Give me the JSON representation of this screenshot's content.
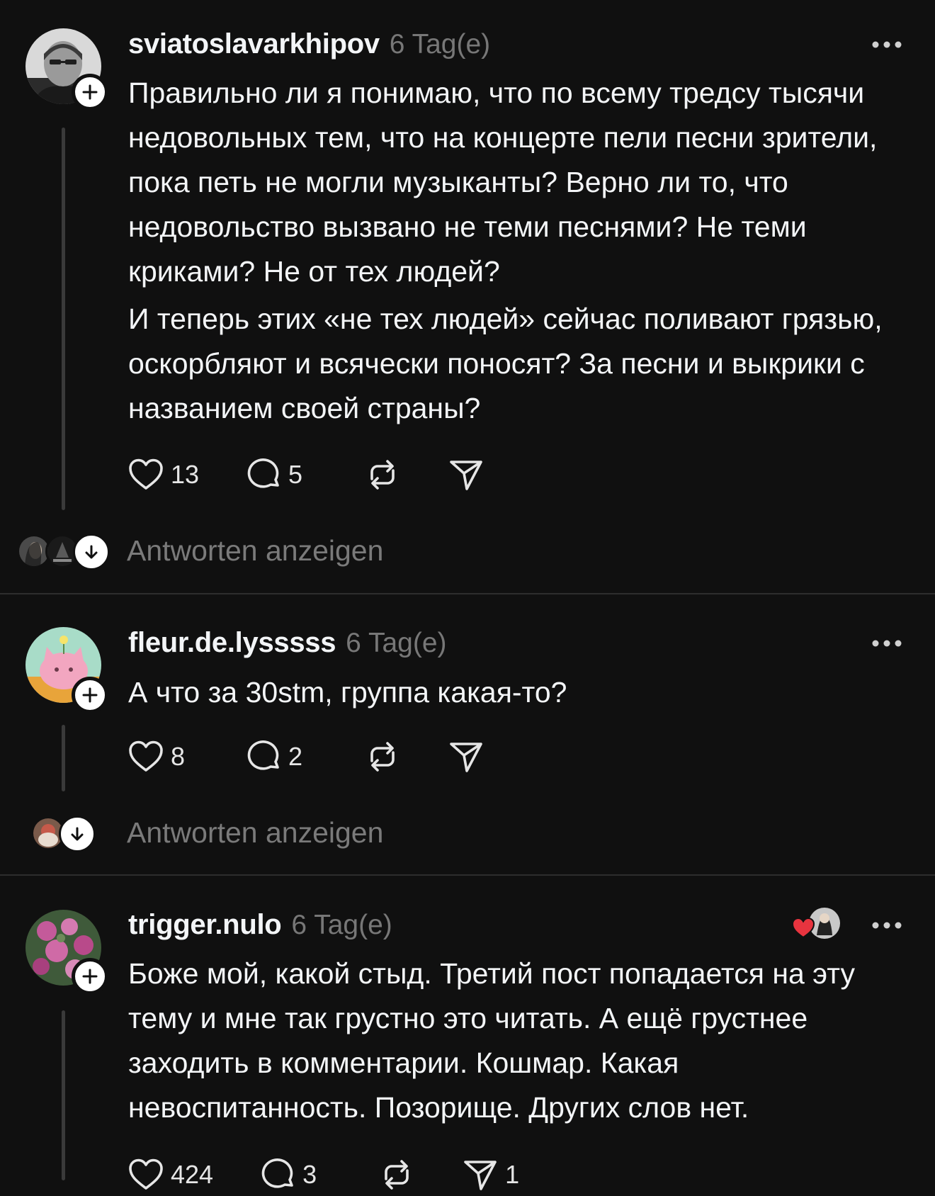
{
  "posts": [
    {
      "username": "sviatoslavarkhipov",
      "time": "6 Tag(e)",
      "paragraphs": [
        "Правильно ли я понимаю, что по всему тредсу тысячи недовольных тем, что на концерте пели песни зрители, пока петь не могли музыканты? Верно ли то, что недовольство вызвано не теми песнями? Не теми криками? Не от тех людей?",
        "И теперь этих «не тех людей» сейчас поливают грязью, оскорбляют и всячески поносят? За песни и выкрики с названием своей страны?"
      ],
      "likes": "13",
      "comments": "5",
      "replies_label": "Antworten anzeigen"
    },
    {
      "username": "fleur.de.lysssss",
      "time": "6 Tag(e)",
      "paragraphs": [
        "А что за 30stm, группа какая-то?"
      ],
      "likes": "8",
      "comments": "2",
      "replies_label": "Antworten anzeigen"
    },
    {
      "username": "trigger.nulo",
      "time": "6 Tag(e)",
      "paragraphs": [
        "Боже мой, какой стыд. Третий пост попадается на эту тему и мне так грустно это читать.  А ещё грустнее заходить в комментарии. Кошмар. Какая невоспитанность. Позорище. Других слов нет."
      ],
      "likes": "424",
      "comments": "3",
      "shares": "1"
    }
  ],
  "icons": {
    "like": "heart-icon",
    "comment": "comment-bubble-icon",
    "repost": "repost-icon",
    "share": "send-icon",
    "more": "more-options-icon",
    "follow": "plus-icon",
    "expand": "arrow-down-icon"
  },
  "colors": {
    "background": "#101010",
    "text": "#f3f5f7",
    "muted": "#777777",
    "divider": "#2d2d2d",
    "liked_heart": "#e8343f"
  }
}
